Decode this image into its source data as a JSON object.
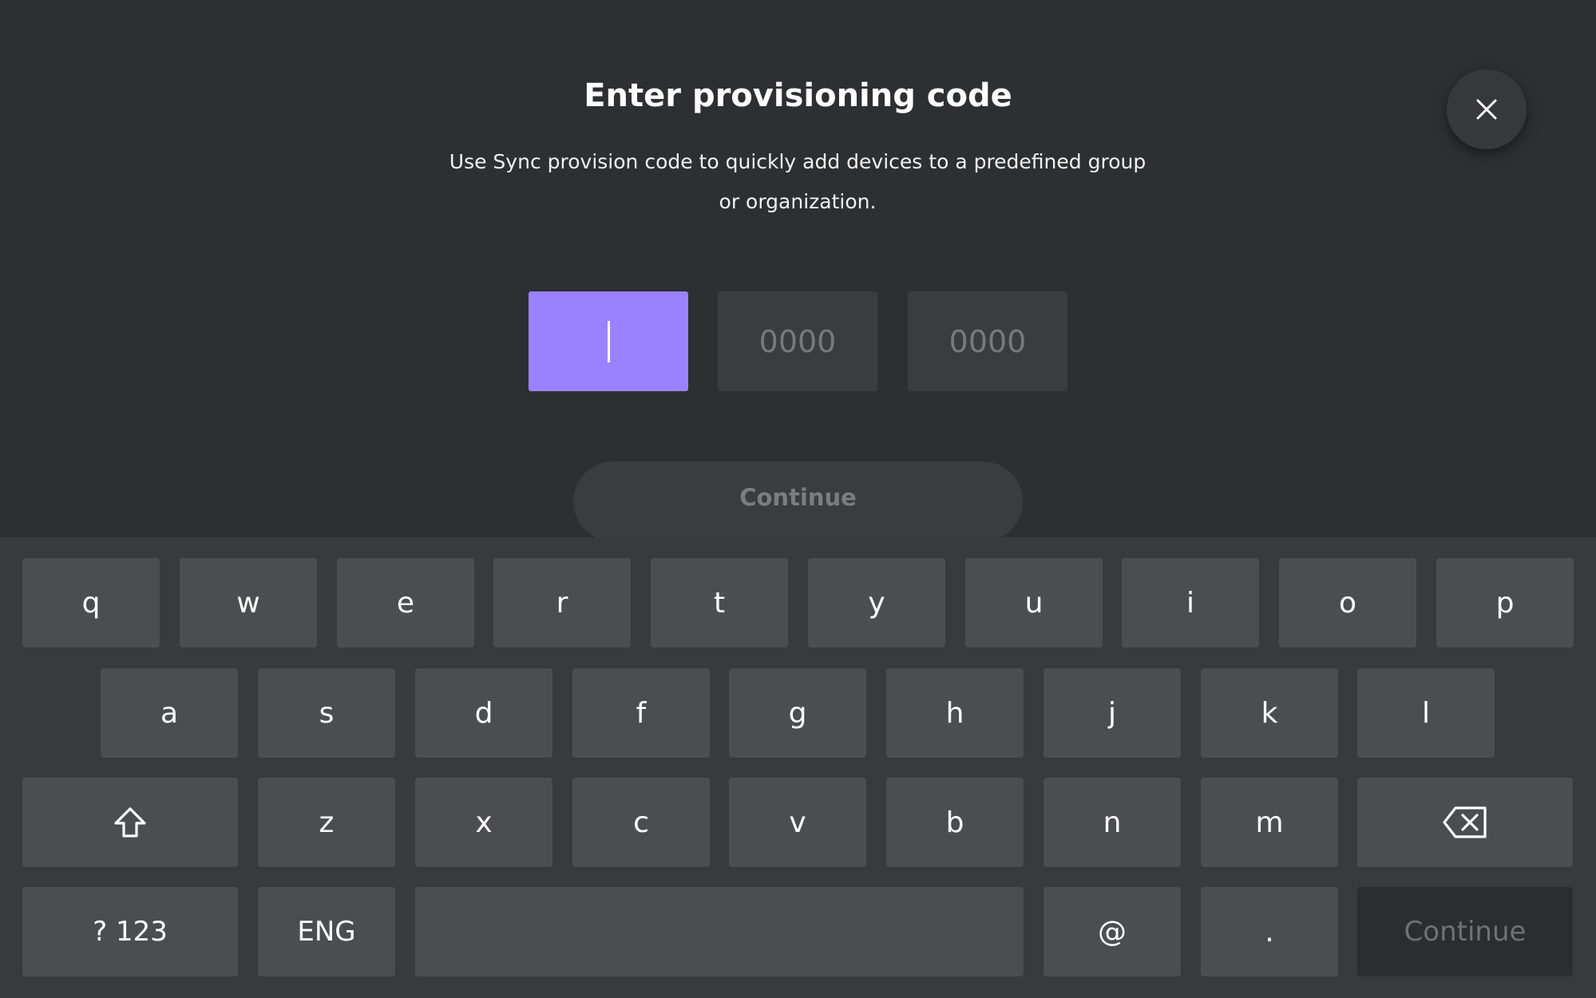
{
  "dialog": {
    "title": "Enter provisioning code",
    "subtitle_line1": "Use Sync provision code to quickly add devices to a predefined group",
    "subtitle_line2": "or organization.",
    "close_icon": "close-icon",
    "code_fields": [
      {
        "value": "",
        "placeholder": "0000",
        "focused": true
      },
      {
        "value": "",
        "placeholder": "0000",
        "focused": false
      },
      {
        "value": "",
        "placeholder": "0000",
        "focused": false
      }
    ],
    "continue_label": "Continue",
    "accent_color": "#9a82ff"
  },
  "keyboard": {
    "row1": [
      "q",
      "w",
      "e",
      "r",
      "t",
      "y",
      "u",
      "i",
      "o",
      "p"
    ],
    "row2": [
      "a",
      "s",
      "d",
      "f",
      "g",
      "h",
      "j",
      "k",
      "l"
    ],
    "row3": [
      "z",
      "x",
      "c",
      "v",
      "b",
      "n",
      "m"
    ],
    "shift_icon": "shift-icon",
    "backspace_icon": "backspace-icon",
    "numbers_label": "? 123",
    "language_label": "ENG",
    "at_label": "@",
    "period_label": ".",
    "continue_label": "Continue"
  }
}
